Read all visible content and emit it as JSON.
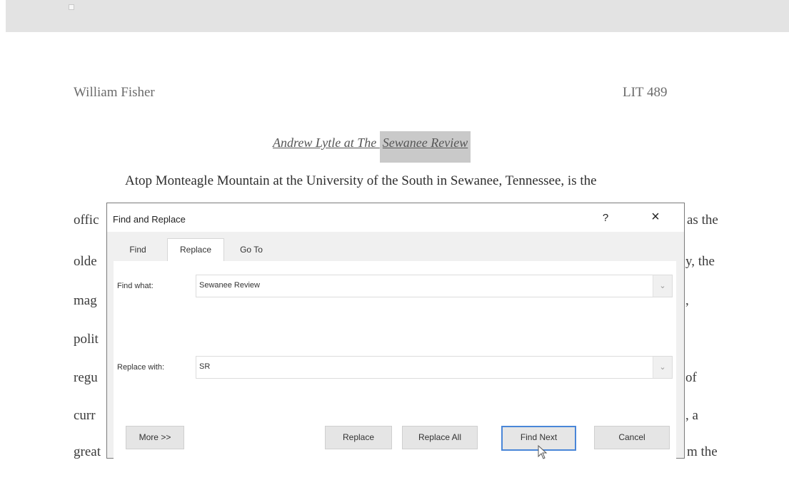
{
  "document": {
    "header_name": "William Fisher",
    "header_course": "LIT 489",
    "title_part1": "Andrew Lytle at The ",
    "title_part2": "Sewanee Review",
    "first_line": "Atop Monteagle Mountain at the University of the South in Sewanee, Tennessee, is the",
    "left_fragments": [
      "offic",
      "olde",
      "mag",
      "polit",
      "regu",
      "curr",
      "great"
    ],
    "right_fragments": [
      "as the",
      "y, the",
      ",",
      "",
      "of",
      ", a",
      "m the"
    ]
  },
  "dialog": {
    "title": "Find and Replace",
    "help_label": "?",
    "close_label": "×",
    "tabs": [
      "Find",
      "Replace",
      "Go To"
    ],
    "find_label": "Find what:",
    "find_value": "Sewanee Review",
    "replace_label": "Replace with:",
    "replace_value": "SR",
    "dropdown_glyph": "⌄",
    "buttons": {
      "more": "More >>",
      "replace": "Replace",
      "replace_all": "Replace All",
      "find_next": "Find Next",
      "cancel": "Cancel"
    }
  }
}
